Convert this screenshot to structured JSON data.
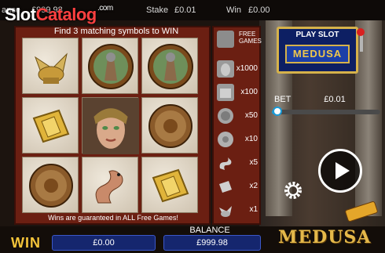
{
  "site_logo": {
    "part1": "Slot",
    "part2": "Catalog",
    "suffix": ".com"
  },
  "topbar": {
    "balance_partial": "ance",
    "balance_value": "£999.98",
    "stake_label": "Stake",
    "stake_value": "£0.01",
    "win_label": "Win",
    "win_value": "£0.00"
  },
  "reels": {
    "header": "Find 3 matching symbols to WIN",
    "footer": "Wins are guaranteed in ALL Free Games!",
    "grid": [
      [
        "winged-helmet",
        "warrior-shield",
        "warrior-shield"
      ],
      [
        "golden-tile",
        "medusa-face",
        "medusa-coin"
      ],
      [
        "medusa-coin",
        "serpent",
        "golden-tile"
      ]
    ]
  },
  "paytable": {
    "free_games_label_1": "FREE",
    "free_games_label_2": "GAMES",
    "rows": [
      {
        "icon": "medusa-face-icon",
        "mult": "x1000"
      },
      {
        "icon": "temple-icon",
        "mult": "x100"
      },
      {
        "icon": "warrior-shield-icon",
        "mult": "x50"
      },
      {
        "icon": "medusa-coin-icon",
        "mult": "x10"
      },
      {
        "icon": "serpent-icon",
        "mult": "x5"
      },
      {
        "icon": "golden-tile-icon",
        "mult": "x2"
      },
      {
        "icon": "winged-helmet-icon",
        "mult": "x1"
      }
    ]
  },
  "play_slot": {
    "label": "PLAY SLOT",
    "game_name": "MEDUSA"
  },
  "bet": {
    "label": "BET",
    "value": "£0.01",
    "level": 0.02
  },
  "bottom": {
    "win_label": "WIN",
    "win_value": "£0.00",
    "balance_label": "BALANCE",
    "balance_value": "£999.98",
    "game_logo": "MEDUSA"
  },
  "colors": {
    "accent_gold": "#f5c53a",
    "panel_red": "#6b1f12",
    "box_blue": "#15266e",
    "slider_blue": "#1a9ad6"
  }
}
